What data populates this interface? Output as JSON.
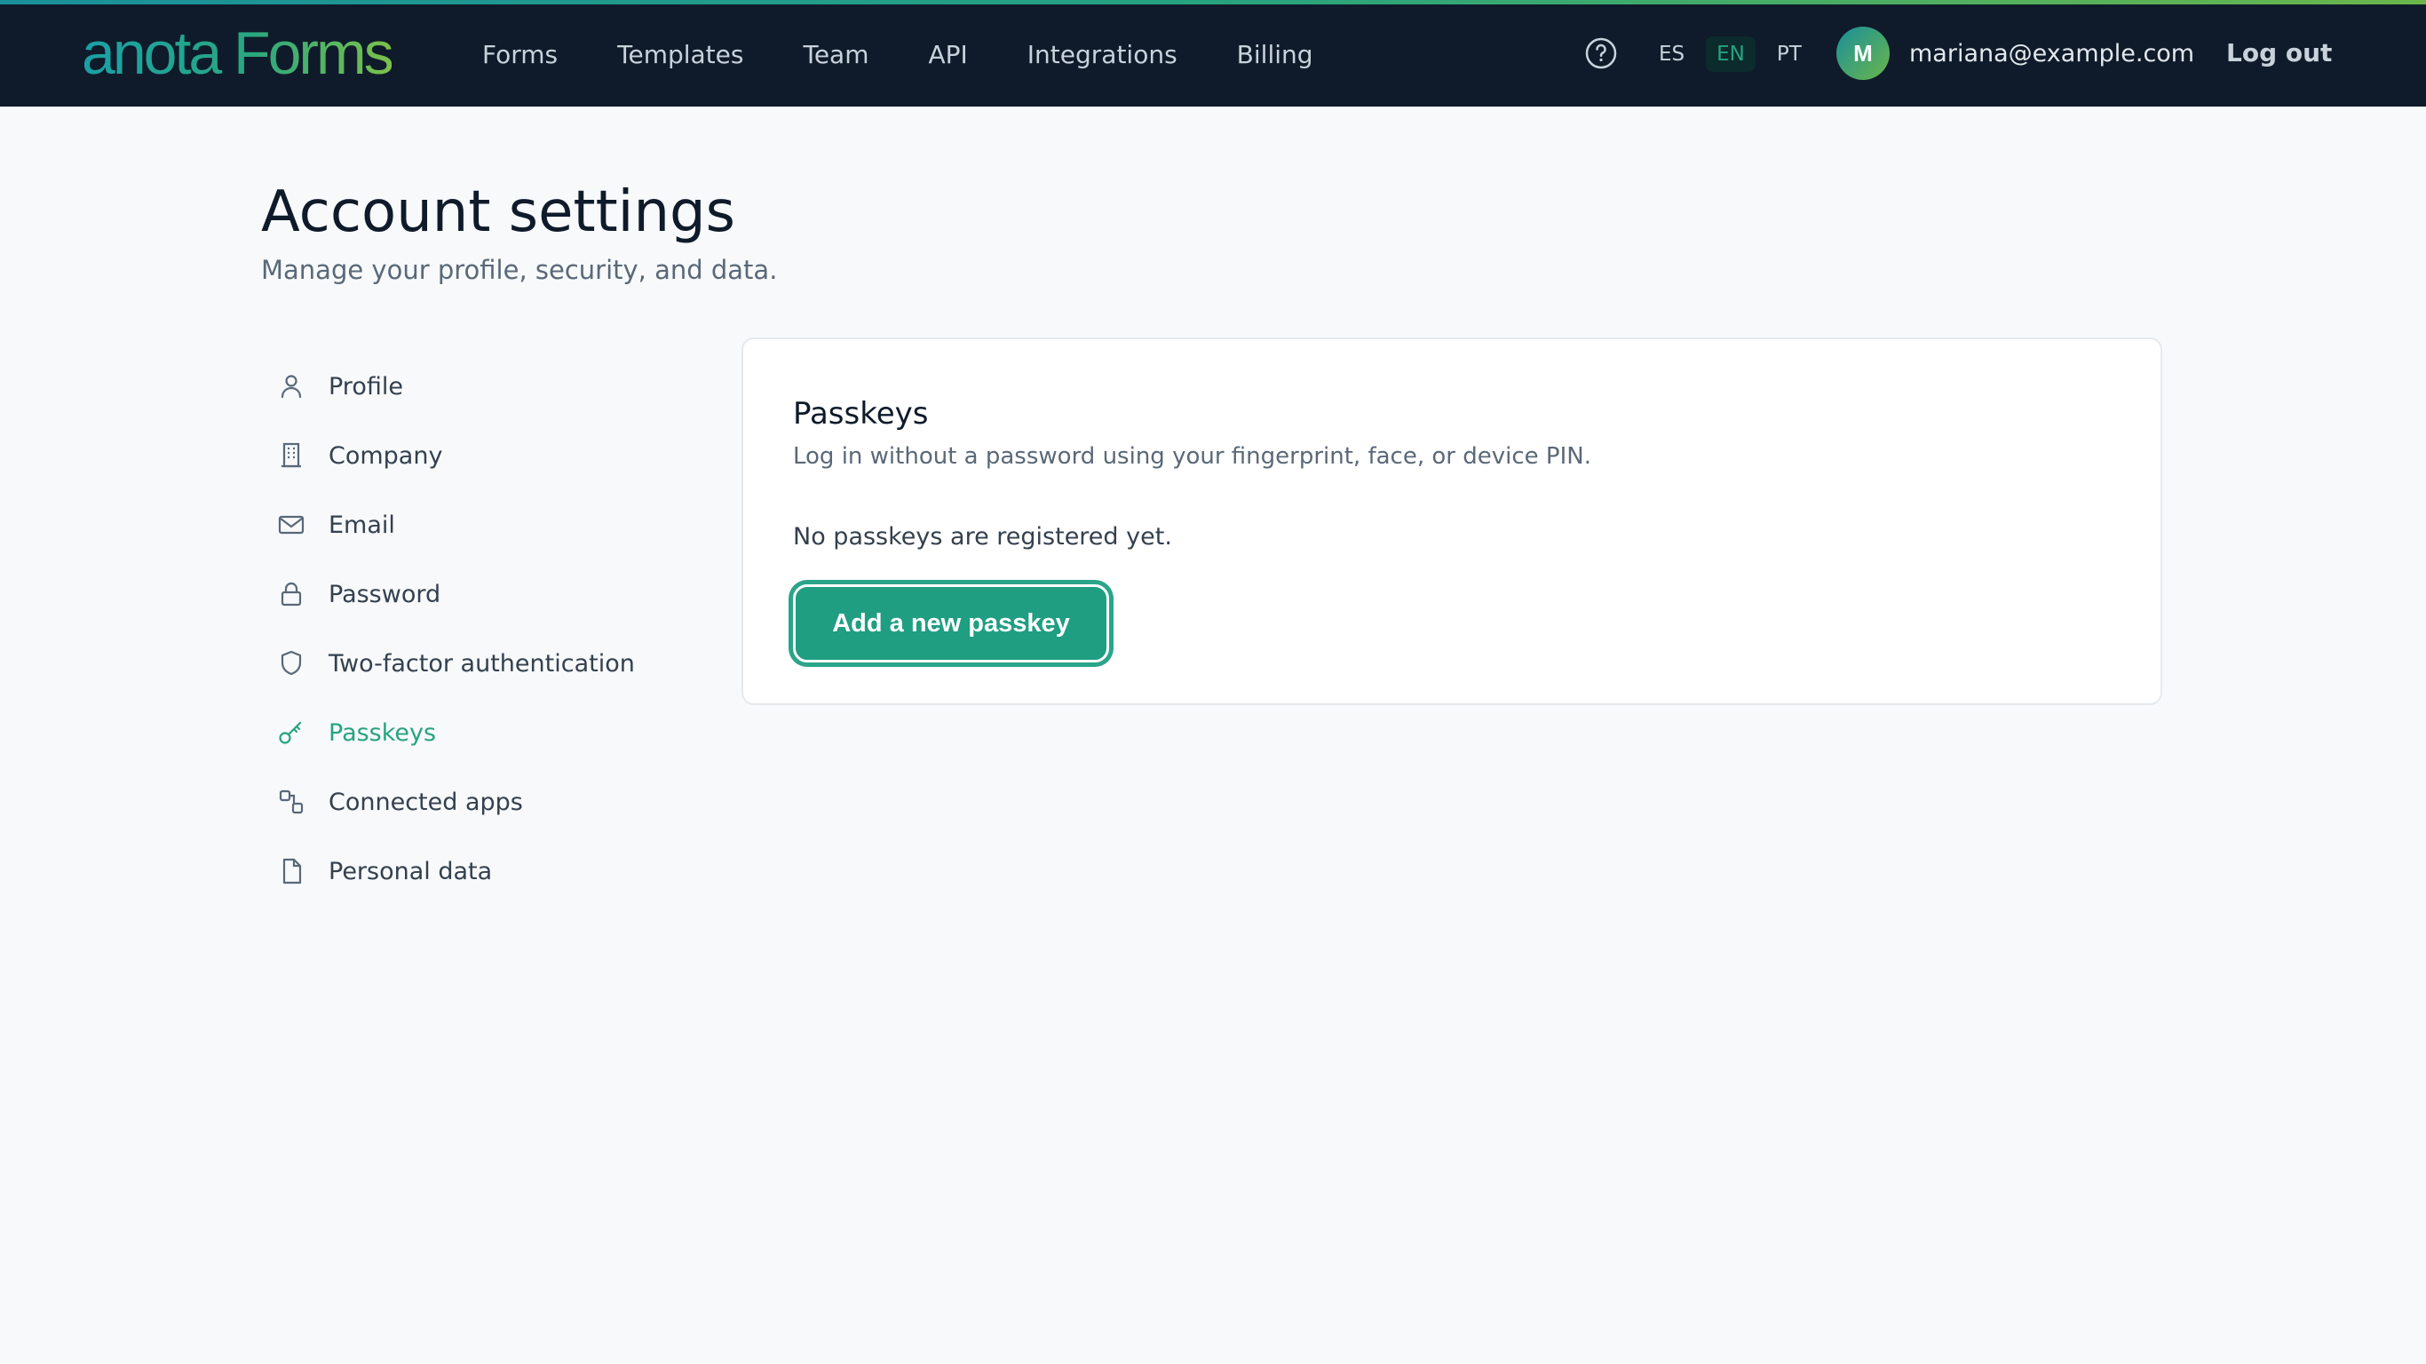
{
  "brand": {
    "logo_text": "anota Forms"
  },
  "nav": {
    "items": [
      "Forms",
      "Templates",
      "Team",
      "API",
      "Integrations",
      "Billing"
    ]
  },
  "header": {
    "help_icon": "question-circle-icon",
    "languages": [
      "ES",
      "EN",
      "PT"
    ],
    "active_language": "EN",
    "avatar_initial": "M",
    "user_email": "mariana@example.com",
    "logout_label": "Log out"
  },
  "page": {
    "title": "Account settings",
    "subtitle": "Manage your profile, security, and data."
  },
  "sidebar": {
    "items": [
      {
        "label": "Profile",
        "icon": "user-icon"
      },
      {
        "label": "Company",
        "icon": "building-icon"
      },
      {
        "label": "Email",
        "icon": "mail-icon"
      },
      {
        "label": "Password",
        "icon": "lock-icon"
      },
      {
        "label": "Two-factor authentication",
        "icon": "shield-icon"
      },
      {
        "label": "Passkeys",
        "icon": "key-icon",
        "active": true
      },
      {
        "label": "Connected apps",
        "icon": "link-apps-icon"
      },
      {
        "label": "Personal data",
        "icon": "document-icon"
      }
    ]
  },
  "card": {
    "title": "Passkeys",
    "description": "Log in without a password using your fingerprint, face, or device PIN.",
    "empty_text": "No passkeys are registered yet.",
    "add_button_label": "Add a new passkey"
  },
  "colors": {
    "topbar_bg": "#0f1b2a",
    "accent": "#27a37f",
    "button_bg": "#1f9e82",
    "page_bg": "#f7f9fb"
  }
}
